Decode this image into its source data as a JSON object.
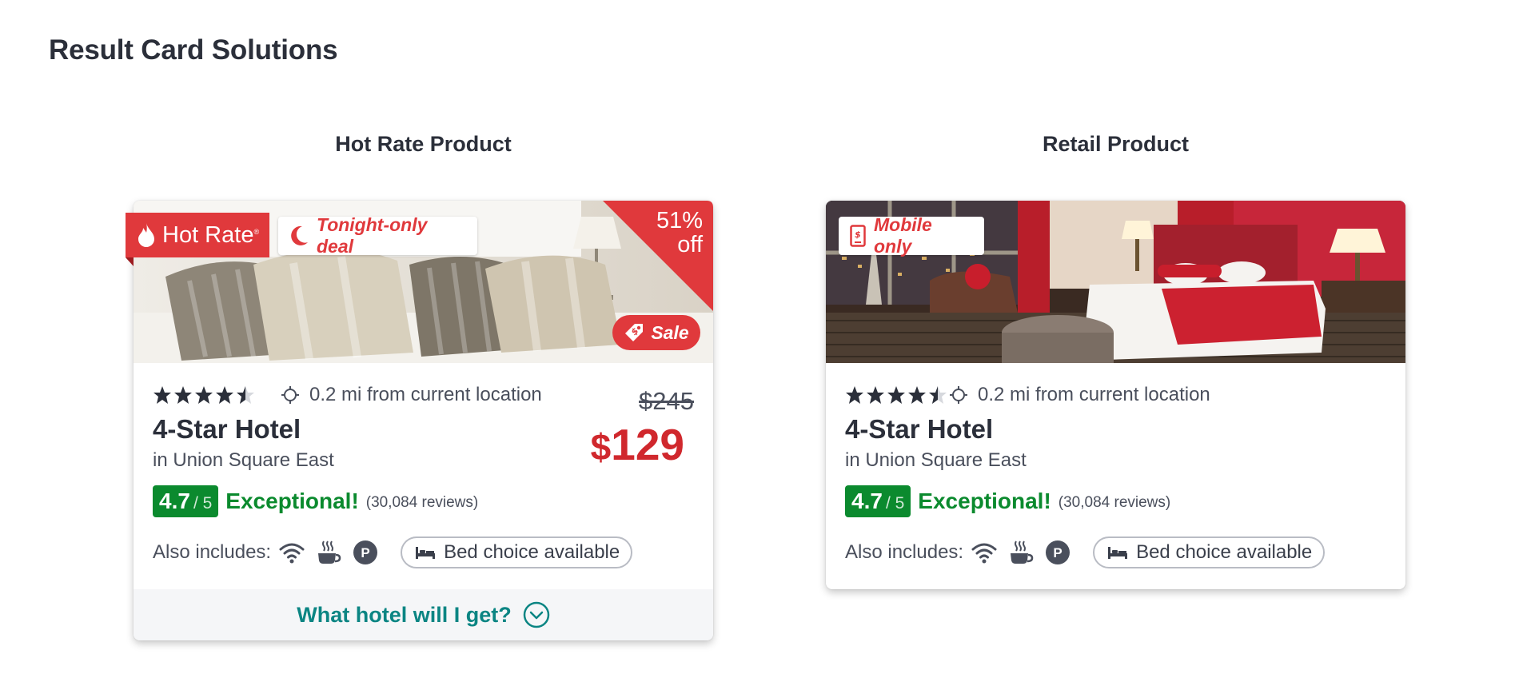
{
  "page": {
    "title": "Result Card Solutions"
  },
  "columns": {
    "left_title": "Hot Rate Product",
    "right_title": "Retail Product"
  },
  "hot_rate_card": {
    "badge_label": "Hot Rate",
    "badge_registered": "®",
    "deal_label": "Tonight-only deal",
    "discount_line1": "51%",
    "discount_line2": "off",
    "sale_label": "Sale",
    "star_rating": 4.5,
    "distance": "0.2 mi from current location",
    "hotel_name": "4-Star Hotel",
    "neighborhood": "in Union Square East",
    "old_price": "$245",
    "price_currency": "$",
    "price_amount": "129",
    "score": "4.7",
    "score_outof": "/ 5",
    "rating_label": "Exceptional!",
    "review_count": "(30,084 reviews)",
    "amenities_label": "Also includes:",
    "amenity_icons": [
      "wifi-icon",
      "coffee-icon",
      "parking-icon"
    ],
    "bed_label": "Bed choice available",
    "reveal_label": "What hotel will I get?"
  },
  "retail_card": {
    "mobile_label": "Mobile only",
    "star_rating": 4.5,
    "distance": "0.2 mi from current location",
    "hotel_name": "4-Star Hotel",
    "neighborhood": "in Union Square East",
    "score": "4.7",
    "score_outof": "/ 5",
    "rating_label": "Exceptional!",
    "review_count": "(30,084 reviews)",
    "amenities_label": "Also includes:",
    "amenity_icons": [
      "wifi-icon",
      "coffee-icon",
      "parking-icon"
    ],
    "bed_label": "Bed choice available"
  },
  "colors": {
    "brand_red": "#e0393c",
    "price_red": "#d0282d",
    "rating_green": "#0b8a2e",
    "teal_link": "#0b8583",
    "text_dark": "#2b2f3a"
  }
}
